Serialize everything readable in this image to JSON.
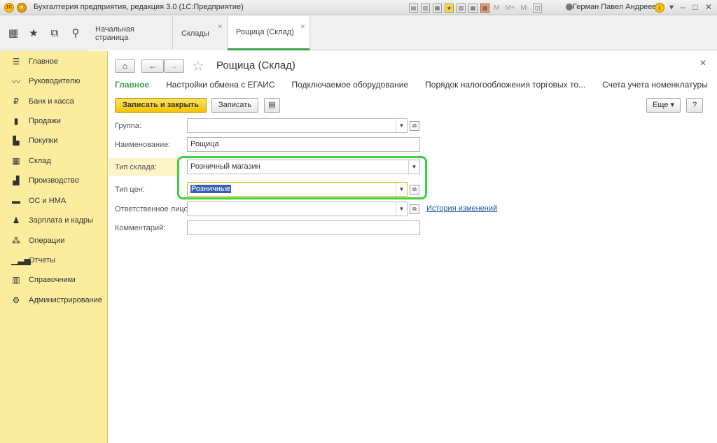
{
  "window": {
    "title": "Бухгалтерия предприятия, редакция 3.0  (1С:Предприятие)",
    "user": "Герман Павел Андреевич",
    "logo_text": "1С",
    "titlebar_icons": [
      "M",
      "M+",
      "M-"
    ]
  },
  "tabs": [
    {
      "label": "Начальная страница",
      "closable": false
    },
    {
      "label": "Склады",
      "closable": true
    },
    {
      "label": "Рощица (Склад)",
      "closable": true,
      "active": true
    }
  ],
  "sidebar": {
    "items": [
      {
        "label": "Главное",
        "icon": "menu-icon"
      },
      {
        "label": "Руководителю",
        "icon": "chart-line-icon"
      },
      {
        "label": "Банк и касса",
        "icon": "ruble-icon"
      },
      {
        "label": "Продажи",
        "icon": "bag-icon"
      },
      {
        "label": "Покупки",
        "icon": "cart-icon"
      },
      {
        "label": "Склад",
        "icon": "warehouse-icon"
      },
      {
        "label": "Производство",
        "icon": "factory-icon"
      },
      {
        "label": "ОС и НМА",
        "icon": "truck-icon"
      },
      {
        "label": "Зарплата и кадры",
        "icon": "person-icon"
      },
      {
        "label": "Операции",
        "icon": "operations-icon"
      },
      {
        "label": "Отчеты",
        "icon": "bar-chart-icon"
      },
      {
        "label": "Справочники",
        "icon": "books-icon"
      },
      {
        "label": "Администрирование",
        "icon": "gear-icon"
      }
    ]
  },
  "form": {
    "title": "Рощица (Склад)",
    "sections": [
      "Главное",
      "Настройки обмена с ЕГАИС",
      "Подключаемое оборудование",
      "Порядок налогообложения торговых то...",
      "Счета учета номенклатуры"
    ],
    "buttons": {
      "save_close": "Записать и закрыть",
      "save": "Записать",
      "more": "Еще",
      "help": "?"
    },
    "fields": {
      "group": {
        "label": "Группа:",
        "value": ""
      },
      "name": {
        "label": "Наименование:",
        "value": "Рощица"
      },
      "warehouse_type": {
        "label": "Тип склада:",
        "value": "Розничный магазин"
      },
      "price_type": {
        "label": "Тип цен:",
        "value": "Розничные"
      },
      "responsible": {
        "label": "Ответственное лицо:",
        "value": ""
      },
      "comment": {
        "label": "Комментарий:",
        "value": ""
      }
    },
    "history_link": "История изменений"
  }
}
